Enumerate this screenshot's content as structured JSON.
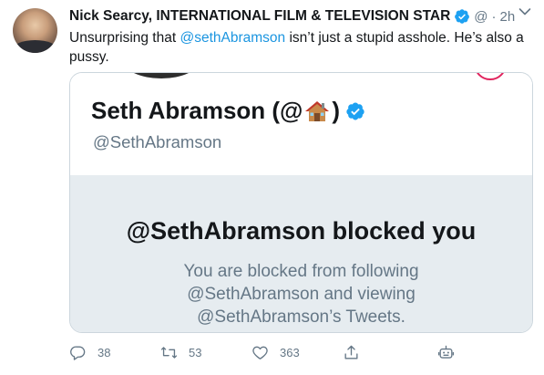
{
  "tweet": {
    "author_name": "Nick Searcy, INTERNATIONAL FILM & TELEVISION STAR",
    "author_handle": "@",
    "separator": "·",
    "timestamp": "2h",
    "text_before": "Unsurprising that ",
    "mention": "@sethAbramson",
    "text_after": " isn’t just a stupid asshole. He’s also a pussy."
  },
  "embedded_screenshot": {
    "profile_name_prefix": "Seth Abramson (@",
    "profile_name_suffix": ")",
    "profile_handle": "@SethAbramson",
    "blocked_title": "@SethAbramson blocked you",
    "blocked_line1": "You are blocked from following",
    "blocked_line2": "@SethAbramson and viewing",
    "blocked_line3": "@SethAbramson’s Tweets."
  },
  "actions": {
    "reply_count": "38",
    "retweet_count": "53",
    "like_count": "363"
  },
  "colors": {
    "accent": "#1da1f2",
    "mention": "#1b95e0",
    "muted": "#657786",
    "blocked_background": "#e6ecf0",
    "notification_ring": "#e0245e"
  },
  "icons": [
    "verified-badge-icon",
    "chevron-down-icon",
    "house-emoji-icon",
    "reply-icon",
    "retweet-icon",
    "like-icon",
    "share-icon",
    "bot-icon"
  ]
}
